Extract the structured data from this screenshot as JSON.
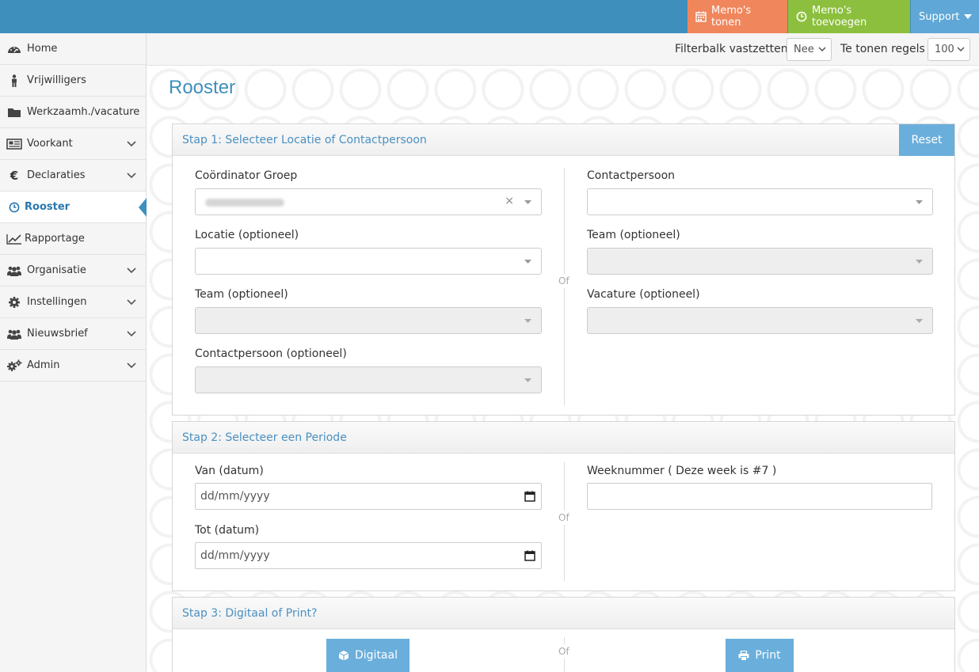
{
  "topbar": {
    "memo_show": "Memo's tonen",
    "memo_add": "Memo's toevoegen",
    "support": "Support"
  },
  "sidebar": {
    "items": [
      {
        "label": "Home",
        "icon": "dashboard-icon"
      },
      {
        "label": "Vrijwilligers",
        "icon": "person-icon"
      },
      {
        "label": "Werkzaamh./vacature",
        "icon": "folder-icon"
      },
      {
        "label": "Voorkant",
        "icon": "newspaper-icon"
      },
      {
        "label": "Declaraties",
        "icon": "euro-icon"
      },
      {
        "label": "Rooster",
        "icon": "clock-icon"
      },
      {
        "label": "Rapportage",
        "icon": "chart-icon"
      },
      {
        "label": "Organisatie",
        "icon": "users-icon"
      },
      {
        "label": "Instellingen",
        "icon": "gear-icon"
      },
      {
        "label": "Nieuwsbrief",
        "icon": "users-icon"
      },
      {
        "label": "Admin",
        "icon": "gears-icon"
      }
    ]
  },
  "filterbar": {
    "fix_label": "Filterbalk vastzetten",
    "fix_value": "Nee",
    "rows_label": "Te tonen regels",
    "rows_value": "100"
  },
  "page": {
    "title": "Rooster"
  },
  "step1": {
    "title": "Stap 1: Selecteer Locatie of Contactpersoon",
    "reset": "Reset",
    "coord_group_label": "Coördinator Groep",
    "clear_symbol": "×",
    "location_label": "Locatie (optioneel)",
    "team_left_label": "Team (optioneel)",
    "contact_optional_label": "Contactpersoon (optioneel)",
    "contact_label": "Contactpersoon",
    "team_right_label": "Team (optioneel)",
    "vacancy_label": "Vacature (optioneel)",
    "or": "Of"
  },
  "step2": {
    "title": "Stap 2: Selecteer een Periode",
    "from_label": "Van (datum)",
    "from_placeholder": "dd/mm/yyyy",
    "to_label": "Tot (datum)",
    "to_placeholder": "dd/mm/yyyy",
    "week_label": "Weeknummer ( Deze week is #7 )",
    "or": "Of"
  },
  "step3": {
    "title": "Stap 3: Digitaal of Print?",
    "digital": "Digitaal",
    "print": "Print",
    "or": "Of"
  },
  "colors": {
    "topbar": "#3f8fbd",
    "memo_show": "#f0865c",
    "memo_add": "#8cbf3d",
    "support": "#5ea7d6",
    "accent": "#6aaedb"
  }
}
